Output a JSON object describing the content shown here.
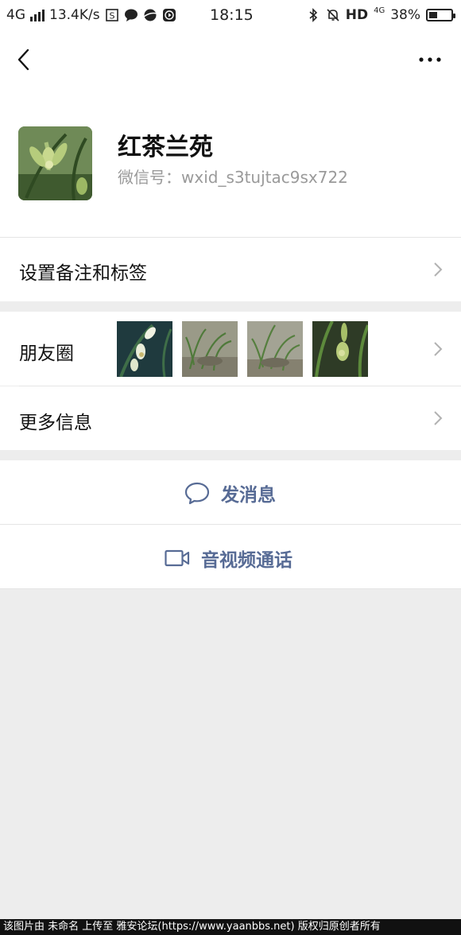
{
  "status_bar": {
    "network": "4G",
    "speed": "13.4K/s",
    "time": "18:15",
    "hd": "HD",
    "lte": "4G",
    "battery_percent": "38%",
    "battery_level": 0.38
  },
  "profile": {
    "name": "红茶兰苑",
    "wechat_id": "微信号：wxid_s3tujtac9sx722"
  },
  "rows": {
    "remark_label": "设置备注和标签",
    "moments_label": "朋友圈",
    "more_info_label": "更多信息"
  },
  "actions": {
    "message_label": "发消息",
    "call_label": "音视频通话"
  },
  "caption": "该图片由 未命名 上传至 雅安论坛(https://www.yaanbbs.net) 版权归原创者所有",
  "colors": {
    "accent": "#576b95",
    "background": "#ededed",
    "surface": "#ffffff"
  }
}
